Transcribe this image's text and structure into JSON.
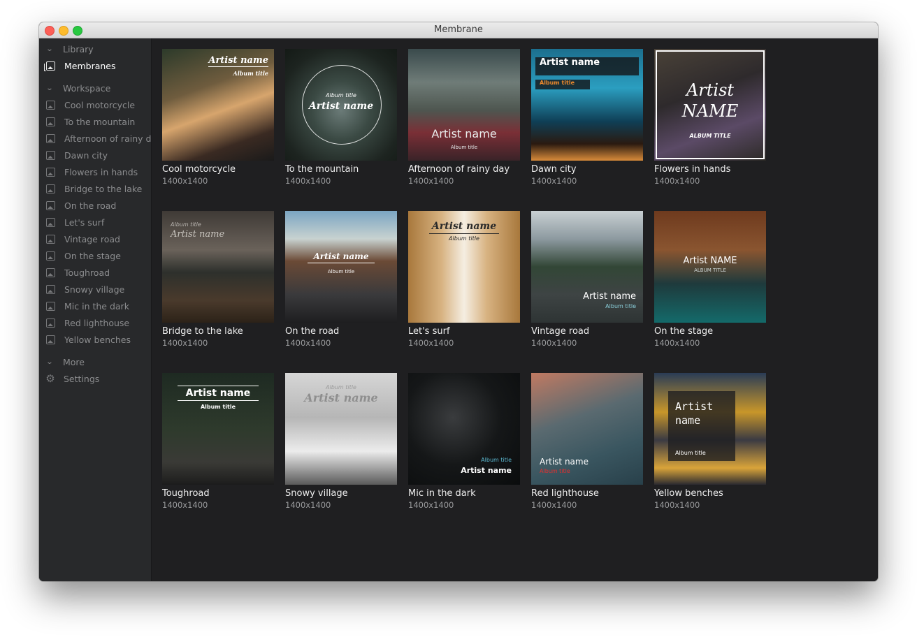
{
  "window": {
    "title": "Membrane"
  },
  "sidebar": {
    "library": {
      "label": "Library",
      "items": [
        {
          "label": "Membranes"
        }
      ]
    },
    "workspace": {
      "label": "Workspace",
      "items": [
        {
          "label": "Cool motorcycle"
        },
        {
          "label": "To the mountain"
        },
        {
          "label": "Afternoon of rainy da"
        },
        {
          "label": "Dawn city"
        },
        {
          "label": "Flowers in hands"
        },
        {
          "label": "Bridge to the lake"
        },
        {
          "label": "On the road"
        },
        {
          "label": "Let's surf"
        },
        {
          "label": "Vintage road"
        },
        {
          "label": "On the stage"
        },
        {
          "label": "Toughroad"
        },
        {
          "label": "Snowy village"
        },
        {
          "label": "Mic in the dark"
        },
        {
          "label": "Red lighthouse"
        },
        {
          "label": "Yellow benches"
        }
      ]
    },
    "more": {
      "label": "More",
      "items": [
        {
          "label": "Settings",
          "icon": "gear-icon"
        }
      ]
    }
  },
  "gallery": {
    "items": [
      {
        "title": "Cool motorcycle",
        "size": "1400x1400",
        "artist": "Artist name",
        "album": "Album title"
      },
      {
        "title": "To the mountain",
        "size": "1400x1400",
        "artist": "Artist name",
        "album": "Album title"
      },
      {
        "title": "Afternoon of rainy day",
        "size": "1400x1400",
        "artist": "Artist name",
        "album": "Album title"
      },
      {
        "title": "Dawn city",
        "size": "1400x1400",
        "artist": "Artist name",
        "album": "Album title"
      },
      {
        "title": "Flowers in hands",
        "size": "1400x1400",
        "artist": "Artist NAME",
        "album": "ALBUM TITLE"
      },
      {
        "title": "Bridge to the lake",
        "size": "1400x1400",
        "artist": "Artist name",
        "album": "Album title"
      },
      {
        "title": "On the road",
        "size": "1400x1400",
        "artist": "Artist name",
        "album": "Album title"
      },
      {
        "title": "Let's surf",
        "size": "1400x1400",
        "artist": "Artist name",
        "album": "Album title"
      },
      {
        "title": "Vintage road",
        "size": "1400x1400",
        "artist": "Artist name",
        "album": "Album title"
      },
      {
        "title": "On the stage",
        "size": "1400x1400",
        "artist": "Artist NAME",
        "album": "ALBUM TITLE"
      },
      {
        "title": "Toughroad",
        "size": "1400x1400",
        "artist": "Artist name",
        "album": "Album title"
      },
      {
        "title": "Snowy village",
        "size": "1400x1400",
        "artist": "Artist name",
        "album": "Album title"
      },
      {
        "title": "Mic in the dark",
        "size": "1400x1400",
        "artist": "Artist name",
        "album": "Album title"
      },
      {
        "title": "Red lighthouse",
        "size": "1400x1400",
        "artist": "Artist name",
        "album": "Album title"
      },
      {
        "title": "Yellow benches",
        "size": "1400x1400",
        "artist": "Artist name",
        "album": "Album title"
      }
    ]
  },
  "fab": {
    "label": "+"
  },
  "colors": {
    "accent": "#2b7fff",
    "sidebar_bg": "#28292b",
    "main_bg": "#1f1f21"
  }
}
